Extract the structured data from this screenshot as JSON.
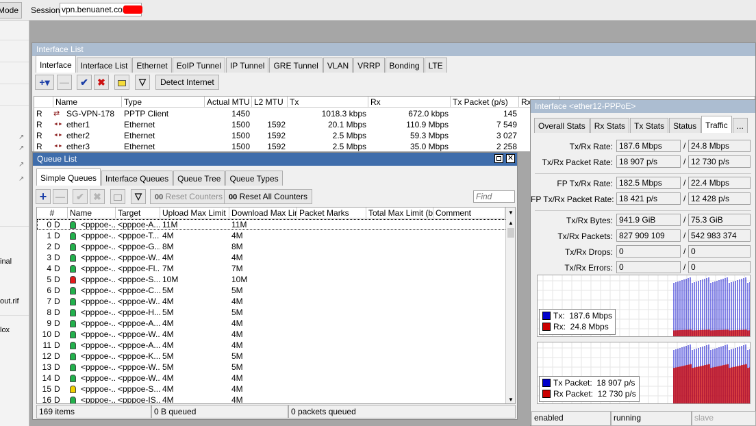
{
  "topbar": {
    "mode_label": "Mode",
    "session_label": "Session:",
    "session_value": "vpn.benuanet.com"
  },
  "left_panel": {
    "items": [
      "inal",
      "out.rif",
      "lox"
    ]
  },
  "interface_list": {
    "title": "Interface List",
    "tabs": [
      "Interface",
      "Interface List",
      "Ethernet",
      "EoIP Tunnel",
      "IP Tunnel",
      "GRE Tunnel",
      "VLAN",
      "VRRP",
      "Bonding",
      "LTE"
    ],
    "selected_tab": "Interface",
    "detect_button": "Detect Internet",
    "columns": [
      "Name",
      "Type",
      "Actual MTU",
      "L2 MTU",
      "Tx",
      "Rx",
      "Tx Packet (p/s)",
      "Rx"
    ],
    "rows": [
      {
        "flag": "R",
        "name": "SG-VPN-178",
        "type": "PPTP Client",
        "mtu": "1450",
        "l2mtu": "",
        "tx": "1018.3 kbps",
        "rx": "672.0 kbps",
        "txp": "145"
      },
      {
        "flag": "R",
        "name": "ether1",
        "type": "Ethernet",
        "mtu": "1500",
        "l2mtu": "1592",
        "tx": "20.1 Mbps",
        "rx": "110.9 Mbps",
        "txp": "7 549"
      },
      {
        "flag": "R",
        "name": "ether2",
        "type": "Ethernet",
        "mtu": "1500",
        "l2mtu": "1592",
        "tx": "2.5 Mbps",
        "rx": "59.3 Mbps",
        "txp": "3 027"
      },
      {
        "flag": "R",
        "name": "ether3",
        "type": "Ethernet",
        "mtu": "1500",
        "l2mtu": "1592",
        "tx": "2.5 Mbps",
        "rx": "35.0 Mbps",
        "txp": "2 258"
      }
    ]
  },
  "queue_list": {
    "title": "Queue List",
    "tabs": [
      "Simple Queues",
      "Interface Queues",
      "Queue Tree",
      "Queue Types"
    ],
    "selected_tab": "Simple Queues",
    "reset_counters": "Reset Counters",
    "reset_all_counters": "Reset All Counters",
    "counter_icon": "00",
    "find_placeholder": "Find",
    "columns": [
      "#",
      "Name",
      "Target",
      "Upload Max Limit",
      "Download Max Limit",
      "Packet Marks",
      "Total Max Limit (bi...",
      "Comment"
    ],
    "rows": [
      {
        "num": "0",
        "flag": "D",
        "icon": "green",
        "name": "<pppoe-...",
        "target": "<pppoe-A...",
        "up": "11M",
        "down": "11M"
      },
      {
        "num": "1",
        "flag": "D",
        "icon": "green",
        "name": "<pppoe-...",
        "target": "<pppoe-T...",
        "up": "4M",
        "down": "4M"
      },
      {
        "num": "2",
        "flag": "D",
        "icon": "green",
        "name": "<pppoe-...",
        "target": "<pppoe-G...",
        "up": "8M",
        "down": "8M"
      },
      {
        "num": "3",
        "flag": "D",
        "icon": "green",
        "name": "<pppoe-...",
        "target": "<pppoe-W...",
        "up": "4M",
        "down": "4M"
      },
      {
        "num": "4",
        "flag": "D",
        "icon": "green",
        "name": "<pppoe-...",
        "target": "<pppoe-Fl...",
        "up": "7M",
        "down": "7M"
      },
      {
        "num": "5",
        "flag": "D",
        "icon": "red",
        "name": "<pppoe-...",
        "target": "<pppoe-S...",
        "up": "10M",
        "down": "10M"
      },
      {
        "num": "6",
        "flag": "D",
        "icon": "green",
        "name": "<pppoe-...",
        "target": "<pppoe-C...",
        "up": "5M",
        "down": "5M"
      },
      {
        "num": "7",
        "flag": "D",
        "icon": "green",
        "name": "<pppoe-...",
        "target": "<pppoe-W...",
        "up": "4M",
        "down": "4M"
      },
      {
        "num": "8",
        "flag": "D",
        "icon": "green",
        "name": "<pppoe-...",
        "target": "<pppoe-H...",
        "up": "5M",
        "down": "5M"
      },
      {
        "num": "9",
        "flag": "D",
        "icon": "green",
        "name": "<pppoe-...",
        "target": "<pppoe-A...",
        "up": "4M",
        "down": "4M"
      },
      {
        "num": "10",
        "flag": "D",
        "icon": "green",
        "name": "<pppoe-...",
        "target": "<pppoe-W...",
        "up": "4M",
        "down": "4M"
      },
      {
        "num": "11",
        "flag": "D",
        "icon": "green",
        "name": "<pppoe-...",
        "target": "<pppoe-A...",
        "up": "4M",
        "down": "4M"
      },
      {
        "num": "12",
        "flag": "D",
        "icon": "green",
        "name": "<pppoe-...",
        "target": "<pppoe-K...",
        "up": "5M",
        "down": "5M"
      },
      {
        "num": "13",
        "flag": "D",
        "icon": "green",
        "name": "<pppoe-...",
        "target": "<pppoe-W...",
        "up": "5M",
        "down": "5M"
      },
      {
        "num": "14",
        "flag": "D",
        "icon": "green",
        "name": "<pppoe-...",
        "target": "<pppoe-W...",
        "up": "4M",
        "down": "4M"
      },
      {
        "num": "15",
        "flag": "D",
        "icon": "yellow",
        "name": "<pppoe-...",
        "target": "<pppoe-S...",
        "up": "4M",
        "down": "4M"
      },
      {
        "num": "16",
        "flag": "D",
        "icon": "green",
        "name": "<pppoe-...",
        "target": "<pppoe-IS...",
        "up": "4M",
        "down": "4M"
      }
    ],
    "status": {
      "items": "169 items",
      "queued": "0 B queued",
      "packets": "0 packets queued"
    }
  },
  "interface_detail": {
    "title": "Interface <ether12-PPPoE>",
    "tabs": [
      "Overall Stats",
      "Rx Stats",
      "Tx Stats",
      "Status",
      "Traffic",
      "..."
    ],
    "selected_tab": "Traffic",
    "stats": [
      {
        "label": "Tx/Rx Rate:",
        "tx": "187.6 Mbps",
        "rx": "24.8 Mbps"
      },
      {
        "label": "Tx/Rx Packet Rate:",
        "tx": "18 907 p/s",
        "rx": "12 730 p/s"
      },
      {
        "label": "FP Tx/Rx Rate:",
        "tx": "182.5 Mbps",
        "rx": "22.4 Mbps"
      },
      {
        "label": "FP Tx/Rx Packet Rate:",
        "tx": "18 421 p/s",
        "rx": "12 428 p/s"
      },
      {
        "label": "Tx/Rx Bytes:",
        "tx": "941.9 GiB",
        "rx": "75.3 GiB"
      },
      {
        "label": "Tx/Rx Packets:",
        "tx": "827 909 109",
        "rx": "542 983 374"
      },
      {
        "label": "Tx/Rx Drops:",
        "tx": "0",
        "rx": "0"
      },
      {
        "label": "Tx/Rx Errors:",
        "tx": "0",
        "rx": "0"
      }
    ],
    "rate_chart": {
      "tx_label": "Tx:",
      "tx_value": "187.6 Mbps",
      "rx_label": "Rx:",
      "rx_value": "24.8 Mbps",
      "tx_color": "#0000cc",
      "rx_color": "#cc0000"
    },
    "packet_chart": {
      "tx_label": "Tx Packet:",
      "tx_value": "18 907 p/s",
      "rx_label": "Rx Packet:",
      "rx_value": "12 730 p/s",
      "tx_color": "#0000cc",
      "rx_color": "#cc0000"
    },
    "status": {
      "state": "enabled",
      "running": "running",
      "slave": "slave"
    }
  }
}
